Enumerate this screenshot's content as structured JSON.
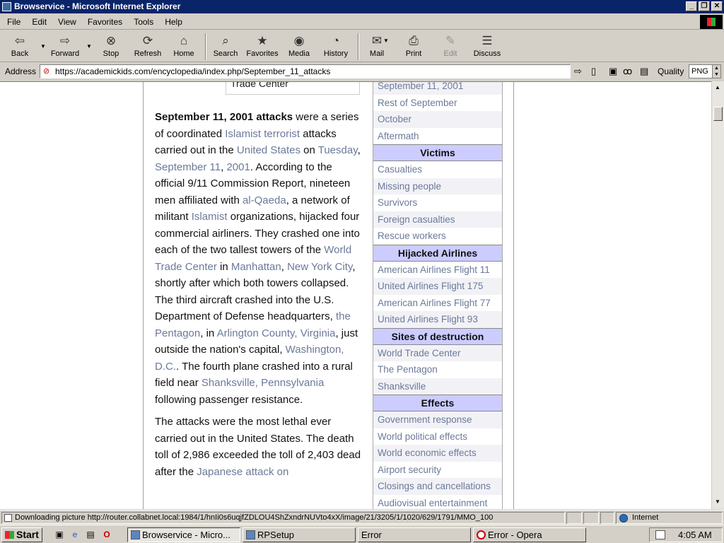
{
  "window": {
    "title": "Browservice - Microsoft Internet Explorer"
  },
  "menu": [
    "File",
    "Edit",
    "View",
    "Favorites",
    "Tools",
    "Help"
  ],
  "toolbar": {
    "back": "Back",
    "forward": "Forward",
    "stop": "Stop",
    "refresh": "Refresh",
    "home": "Home",
    "search": "Search",
    "favorites": "Favorites",
    "media": "Media",
    "history": "History",
    "mail": "Mail",
    "print": "Print",
    "edit": "Edit",
    "discuss": "Discuss"
  },
  "address": {
    "label": "Address",
    "url": "https://academickids.com/encyclopedia/index.php/September_11_attacks",
    "quality_label": "Quality",
    "quality_value": "PNG"
  },
  "page": {
    "image_caption": "Trade Center",
    "p1": {
      "bold": "September 11, 2001 attacks",
      "t1": " were a series of coordinated ",
      "l1": "Islamist terrorist",
      "t2": " attacks carried out in the ",
      "l2": "United States",
      "t3": " on ",
      "l3": "Tuesday",
      "t4": ", ",
      "l4": "September 11",
      "t5": ", ",
      "l5": "2001",
      "t6": ". According to the official 9/11 Commission Report, nineteen men affiliated with ",
      "l6": "al-Qaeda",
      "t7": ", a network of militant ",
      "l7": "Islamist",
      "t8": " organizations, hijacked four commercial airliners. They crashed one into each of the two tallest towers of the ",
      "l8": "World Trade Center",
      "t9": " in ",
      "l9": "Manhattan",
      "t10": ", ",
      "l10": "New York City",
      "t11": ", shortly after which both towers collapsed. The third aircraft crashed into the U.S. Department of Defense headquarters, ",
      "l11": "the Pentagon",
      "t12": ", in ",
      "l12": "Arlington County, Virginia",
      "t13": ", just outside the nation's capital, ",
      "l13": "Washington, D.C.",
      "t14": ". The fourth plane crashed into a rural field near ",
      "l14": "Shanksville, Pennsylvania",
      "t15": " following passenger resistance."
    },
    "p2": {
      "t1": "The attacks were the most lethal ever carried out in the United States. The death toll of 2,986 exceeded the toll of 2,403 dead after the ",
      "l1": "Japanese attack on"
    }
  },
  "infobox": {
    "timeline": [
      "September 11, 2001",
      "Rest of September",
      "October",
      "Aftermath"
    ],
    "victims_header": "Victims",
    "victims": [
      "Casualties",
      "Missing people",
      "Survivors",
      "Foreign casualties",
      "Rescue workers"
    ],
    "airlines_header": "Hijacked Airlines",
    "airlines": [
      "American Airlines Flight 11",
      "United Airlines Flight 175",
      "American Airlines Flight 77",
      "United Airlines Flight 93"
    ],
    "sites_header": "Sites of destruction",
    "sites": [
      "World Trade Center",
      "The Pentagon",
      "Shanksville"
    ],
    "effects_header": "Effects",
    "effects": [
      "Government response",
      "World political effects",
      "World economic effects",
      "Airport security",
      "Closings and cancellations",
      "Audiovisual entertainment"
    ]
  },
  "status": {
    "text": "Downloading picture http://router.collabnet.local:1984/1/hnIi0s6uqjfZDLOU4ShZxndrNUVto4xX/image/21/3205/1/1020/629/1791/MMO_100",
    "zone": "Internet"
  },
  "taskbar": {
    "start": "Start",
    "tasks": [
      "Browservice - Micro...",
      "RPSetup",
      "Error",
      "Error - Opera"
    ],
    "clock": "4:05 AM"
  }
}
